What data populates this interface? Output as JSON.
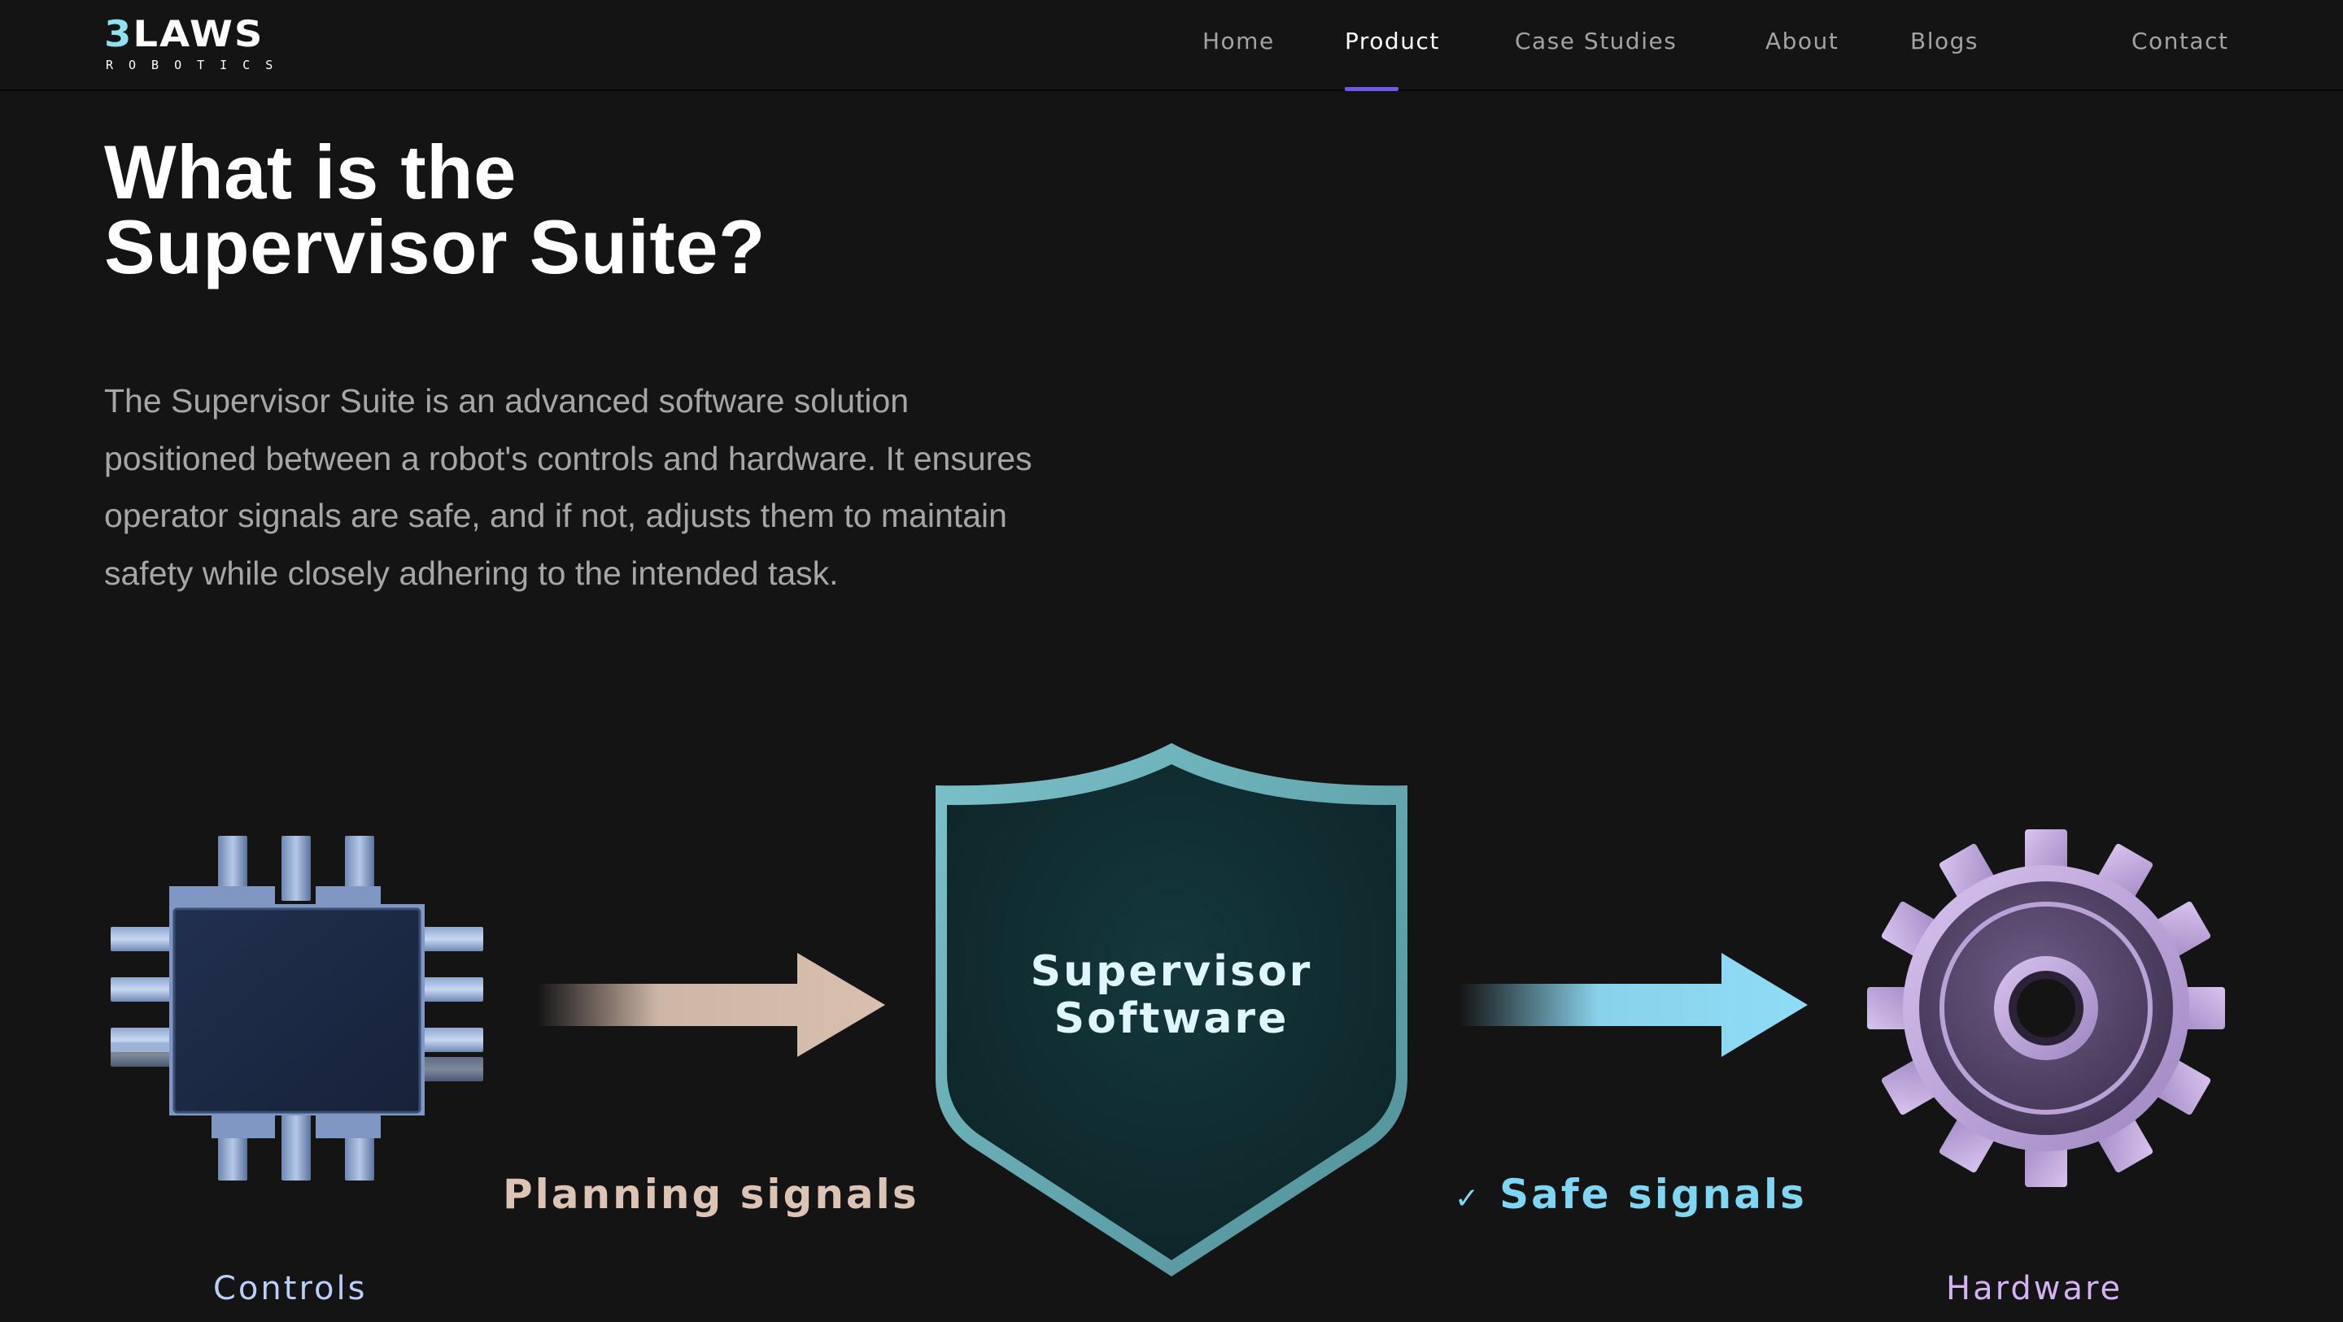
{
  "brand": {
    "logo_main_prefix": "3",
    "logo_main_rest": "LAWS",
    "logo_sub": "ROBOTICS"
  },
  "nav": {
    "items": [
      {
        "label": "Home",
        "active": false
      },
      {
        "label": "Product",
        "active": true
      },
      {
        "label": "Case Studies",
        "active": false
      },
      {
        "label": "About",
        "active": false
      },
      {
        "label": "Blogs",
        "active": false
      },
      {
        "label": "Contact",
        "active": false
      }
    ],
    "active_underline_color": "#6d5ae6"
  },
  "hero": {
    "title_lines": [
      "What is the",
      "Supervisor Suite?"
    ],
    "description_lines": [
      "The Supervisor Suite is an advanced software solution",
      "positioned between a robot's controls and hardware. It ensures",
      "operator signals are safe, and if not, adjusts them to maintain",
      "safety while closely adhering to the intended task."
    ]
  },
  "diagram": {
    "controls": {
      "label": "Controls",
      "icon": "chip-icon",
      "color": "#b9cff7"
    },
    "planning": {
      "label": "Planning signals",
      "arrow_color": "#d8bfae"
    },
    "supervisor": {
      "line1": "Supervisor",
      "line2": "Software",
      "icon": "shield-icon"
    },
    "safe": {
      "check": "✓",
      "label": "Safe signals",
      "arrow_color": "#8fdcf6"
    },
    "hardware": {
      "label": "Hardware",
      "icon": "gear-icon",
      "color": "#d4b2f3"
    }
  }
}
